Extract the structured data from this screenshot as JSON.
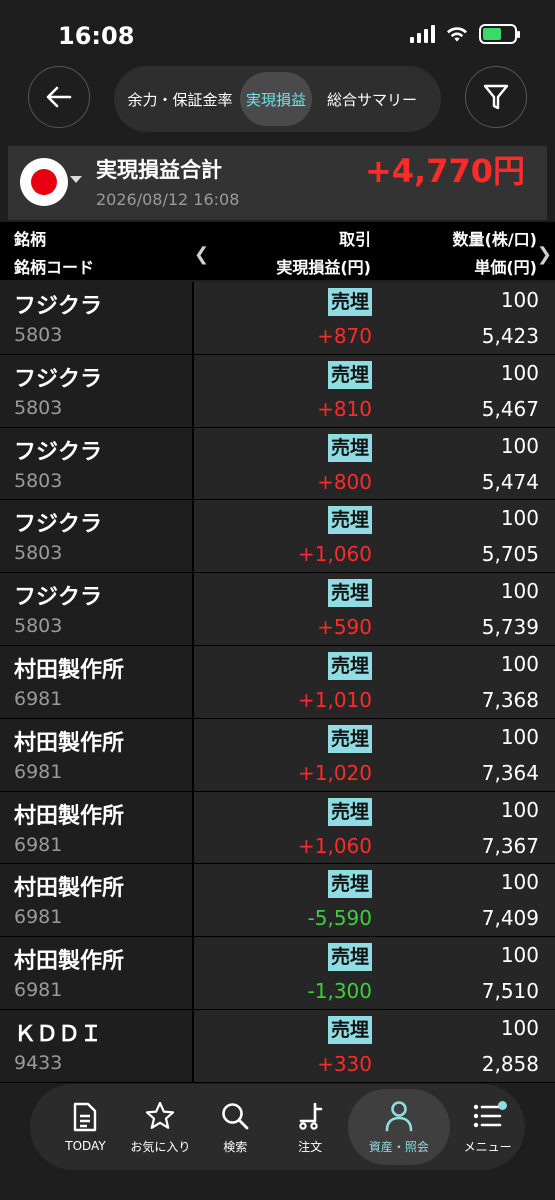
{
  "status_bar": {
    "time": "16:08"
  },
  "header": {
    "tabs": [
      {
        "label": "余力・保証金率",
        "active": false
      },
      {
        "label": "実現損益",
        "active": true
      },
      {
        "label": "総合サマリー",
        "active": false
      }
    ]
  },
  "summary": {
    "title": "実現損益合計",
    "datetime": "2026/08/12 16:08",
    "total": "+4,770円",
    "flag_icon": "japan-flag-icon"
  },
  "columns": {
    "col1_line1": "銘柄",
    "col1_line2": "銘柄コード",
    "col2_line1": "取引",
    "col2_line2": "実現損益(円)",
    "col3_line1": "数量(株/口)",
    "col3_line2": "単価(円)"
  },
  "rows": [
    {
      "name": "フジクラ",
      "code": "5803",
      "trade": "売埋",
      "pl": "+870",
      "qty": "100",
      "price": "5,423"
    },
    {
      "name": "フジクラ",
      "code": "5803",
      "trade": "売埋",
      "pl": "+810",
      "qty": "100",
      "price": "5,467"
    },
    {
      "name": "フジクラ",
      "code": "5803",
      "trade": "売埋",
      "pl": "+800",
      "qty": "100",
      "price": "5,474"
    },
    {
      "name": "フジクラ",
      "code": "5803",
      "trade": "売埋",
      "pl": "+1,060",
      "qty": "100",
      "price": "5,705"
    },
    {
      "name": "フジクラ",
      "code": "5803",
      "trade": "売埋",
      "pl": "+590",
      "qty": "100",
      "price": "5,739"
    },
    {
      "name": "村田製作所",
      "code": "6981",
      "trade": "売埋",
      "pl": "+1,010",
      "qty": "100",
      "price": "7,368"
    },
    {
      "name": "村田製作所",
      "code": "6981",
      "trade": "売埋",
      "pl": "+1,020",
      "qty": "100",
      "price": "7,364"
    },
    {
      "name": "村田製作所",
      "code": "6981",
      "trade": "売埋",
      "pl": "+1,060",
      "qty": "100",
      "price": "7,367"
    },
    {
      "name": "村田製作所",
      "code": "6981",
      "trade": "売埋",
      "pl": "-5,590",
      "qty": "100",
      "price": "7,409"
    },
    {
      "name": "村田製作所",
      "code": "6981",
      "trade": "売埋",
      "pl": "-1,300",
      "qty": "100",
      "price": "7,510"
    },
    {
      "name": "ＫＤＤＩ",
      "code": "9433",
      "trade": "売埋",
      "pl": "+330",
      "qty": "100",
      "price": "2,858"
    }
  ],
  "colors": {
    "positive": "#ff2a2a",
    "negative": "#3ecf3e",
    "accent": "#8fdde2"
  },
  "tabbar": [
    {
      "label": "TODAY",
      "icon": "document-icon",
      "active": false
    },
    {
      "label": "お気に入り",
      "icon": "star-icon",
      "active": false
    },
    {
      "label": "検索",
      "icon": "search-icon",
      "active": false
    },
    {
      "label": "注文",
      "icon": "cart-icon",
      "active": false
    },
    {
      "label": "資産・照会",
      "icon": "person-icon",
      "active": true
    },
    {
      "label": "メニュー",
      "icon": "menu-list-icon",
      "active": false
    }
  ]
}
